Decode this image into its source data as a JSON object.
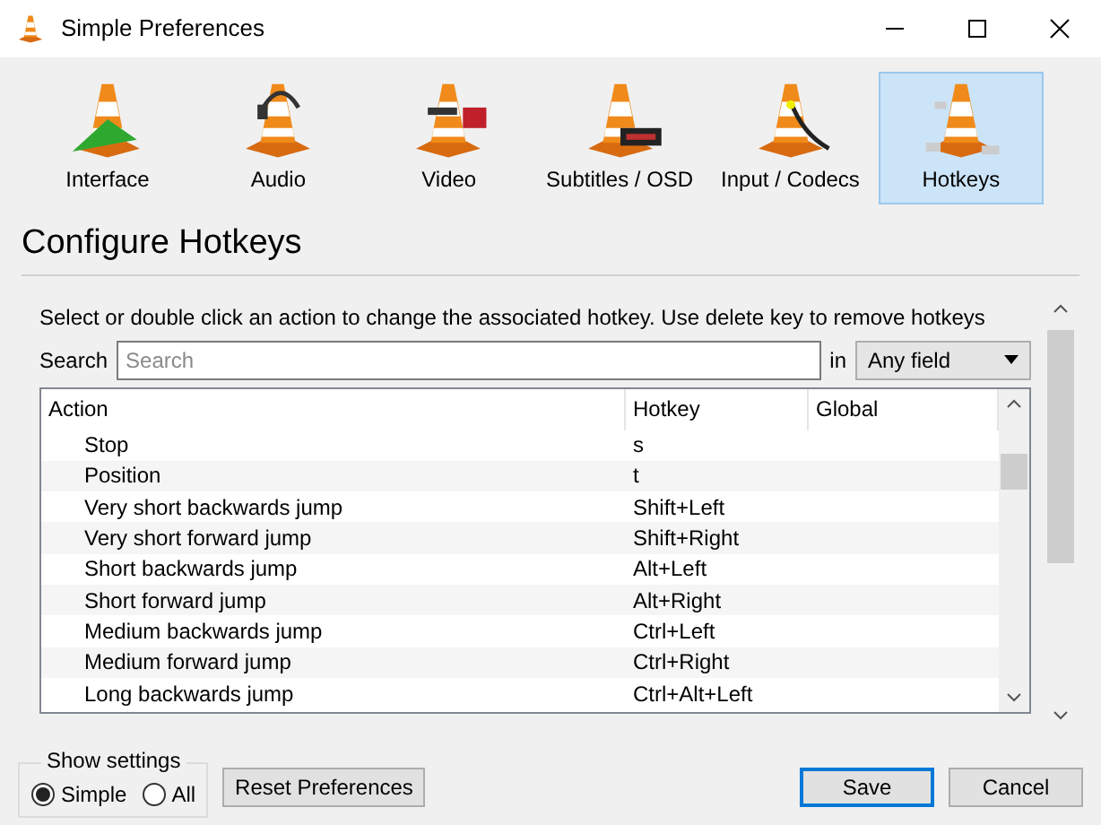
{
  "window": {
    "title": "Simple Preferences"
  },
  "tabs": [
    {
      "label": "Interface",
      "selected": false
    },
    {
      "label": "Audio",
      "selected": false
    },
    {
      "label": "Video",
      "selected": false
    },
    {
      "label": "Subtitles / OSD",
      "selected": false
    },
    {
      "label": "Input / Codecs",
      "selected": false
    },
    {
      "label": "Hotkeys",
      "selected": true
    }
  ],
  "heading": "Configure Hotkeys",
  "description": "Select or double click an action to change the associated hotkey. Use delete key to remove hotkeys",
  "search": {
    "label": "Search",
    "placeholder": "Search",
    "in_label": "in",
    "field_select": "Any field"
  },
  "table": {
    "columns": [
      "Action",
      "Hotkey",
      "Global"
    ],
    "rows": [
      {
        "action": "Stop",
        "hotkey": "s"
      },
      {
        "action": "Position",
        "hotkey": "t"
      },
      {
        "action": "Very short backwards jump",
        "hotkey": "Shift+Left"
      },
      {
        "action": "Very short forward jump",
        "hotkey": "Shift+Right"
      },
      {
        "action": "Short backwards jump",
        "hotkey": "Alt+Left"
      },
      {
        "action": "Short forward jump",
        "hotkey": "Alt+Right"
      },
      {
        "action": "Medium backwards jump",
        "hotkey": "Ctrl+Left"
      },
      {
        "action": "Medium forward jump",
        "hotkey": "Ctrl+Right"
      },
      {
        "action": "Long backwards jump",
        "hotkey": "Ctrl+Alt+Left"
      }
    ]
  },
  "show_settings": {
    "title": "Show settings",
    "options": [
      {
        "label": "Simple",
        "selected": true
      },
      {
        "label": "All",
        "selected": false
      }
    ]
  },
  "buttons": [
    {
      "label": "Reset Preferences",
      "default": false
    },
    {
      "label": "Save",
      "default": true
    },
    {
      "label": "Cancel",
      "default": false
    }
  ]
}
